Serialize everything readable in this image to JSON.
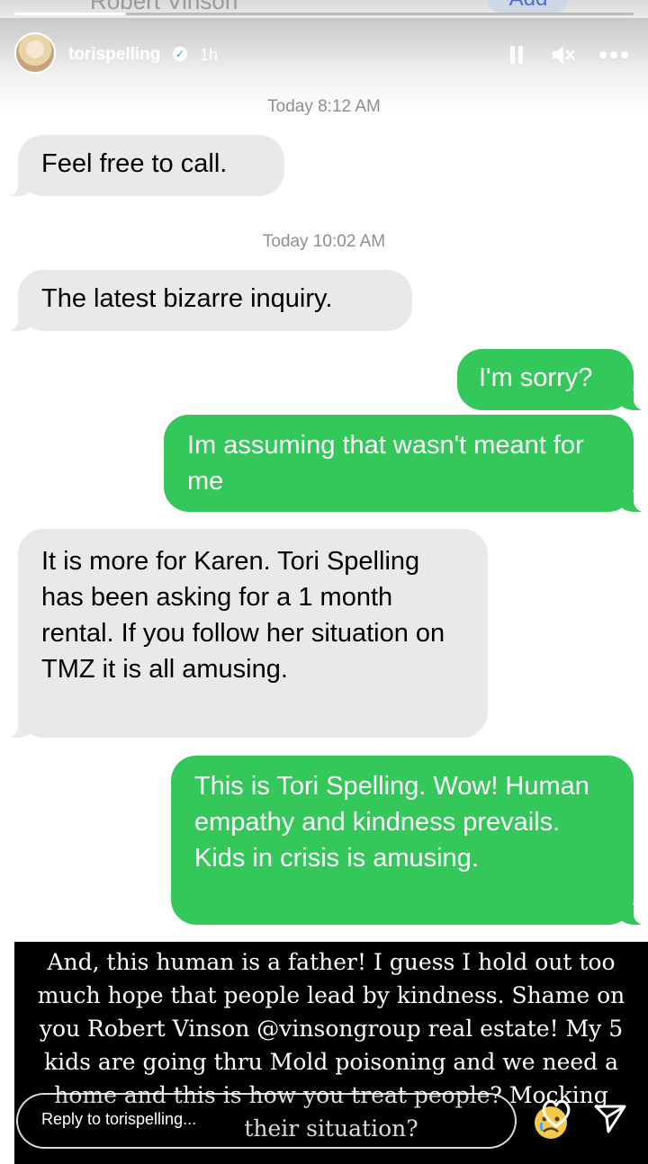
{
  "contact_header": {
    "name": "Robert Vinson",
    "add_label": "Add"
  },
  "story": {
    "progress": 0.18,
    "username": "torispelling",
    "time_ago": "1h",
    "verified_icon": "verified-badge-icon",
    "controls": [
      "pause-icon",
      "mute-icon",
      "more-icon"
    ]
  },
  "messages": [
    {
      "type": "timestamp",
      "text": "Today 8:12 AM"
    },
    {
      "type": "incoming",
      "text": "Feel free to call."
    },
    {
      "type": "timestamp",
      "text": "Today 10:02 AM"
    },
    {
      "type": "incoming",
      "text": "The latest bizarre inquiry."
    },
    {
      "type": "outgoing",
      "text": "I'm sorry?"
    },
    {
      "type": "outgoing",
      "text": "Im assuming that wasn't meant for me"
    },
    {
      "type": "incoming",
      "text": "It is more for Karen. Tori Spelling has been asking for a 1 month rental. If you follow her situation on TMZ it is all amusing."
    },
    {
      "type": "outgoing",
      "text": "This is Tori Spelling. Wow! Human empathy and kindness prevails. Kids in crisis is amusing."
    }
  ],
  "caption": {
    "text": "And, this human is a father! I guess I hold out too much hope that people lead by kindness. Shame on you Robert Vinson @vinsongroup real estate! My 5 kids are going thru Mold poisoning and we need a home and this is how you treat people? Mocking their situation?"
  },
  "reply": {
    "placeholder": "Reply to torispelling...",
    "emoji": "crying-face-icon",
    "like_icon": "heart-icon",
    "send_icon": "send-icon"
  },
  "colors": {
    "incoming_bubble": "#e9e9eb",
    "outgoing_bubble": "#34c759",
    "timestamp": "#8e8e93",
    "caption_bg": "#000000"
  }
}
